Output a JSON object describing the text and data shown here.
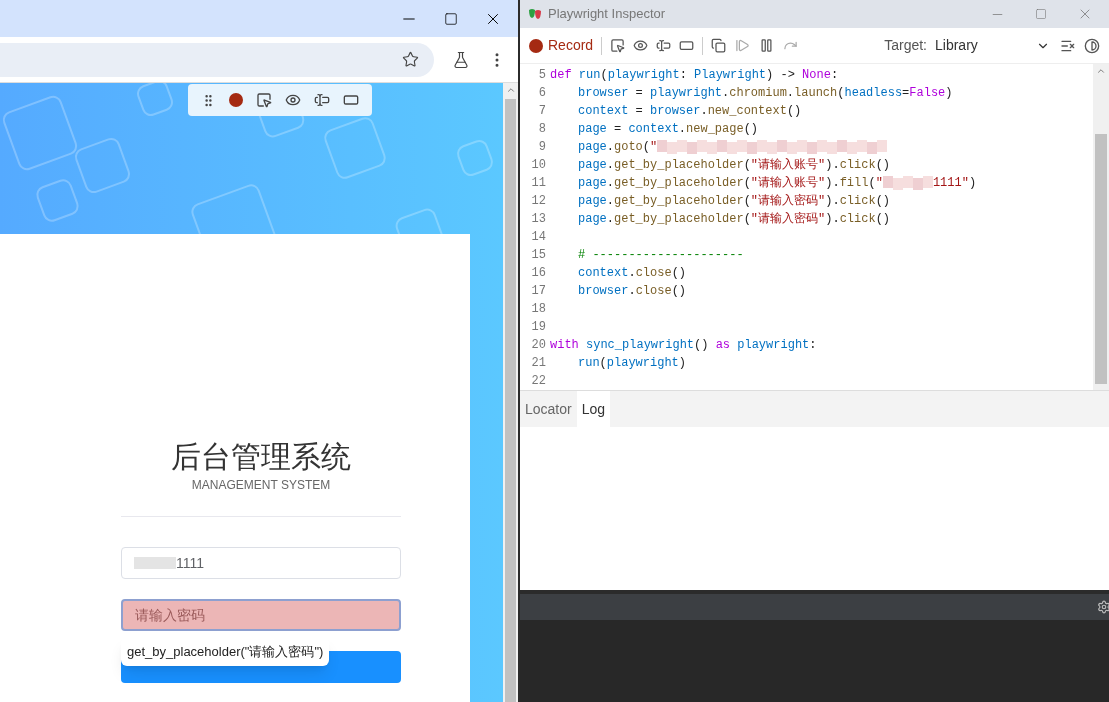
{
  "browser": {
    "login": {
      "title": "后台管理系统",
      "subtitle": "MANAGEMENT SYSTEM",
      "username_value": "1111",
      "password_placeholder": "请输入密码",
      "password_highlighted": true,
      "tooltip": "get_by_placeholder(\"请输入密码\")"
    }
  },
  "inspector": {
    "title": "Playwright Inspector",
    "record_label": "Record",
    "recording": true,
    "target_label": "Target:",
    "target_value": "Library",
    "code_lines": [
      {
        "number": "5",
        "indented": false,
        "tokens": [
          {
            "kind": "keyword",
            "text": "def "
          },
          {
            "kind": "name",
            "text": "run"
          },
          {
            "kind": "plain",
            "text": "("
          },
          {
            "kind": "name",
            "text": "playwright"
          },
          {
            "kind": "plain",
            "text": ": "
          },
          {
            "kind": "name",
            "text": "Playwright"
          },
          {
            "kind": "plain",
            "text": ") -> "
          },
          {
            "kind": "keyword",
            "text": "None"
          },
          {
            "kind": "plain",
            "text": ":"
          }
        ]
      },
      {
        "number": "6",
        "indented": true,
        "tokens": [
          {
            "kind": "name",
            "text": "browser"
          },
          {
            "kind": "plain",
            "text": " = "
          },
          {
            "kind": "name",
            "text": "playwright"
          },
          {
            "kind": "plain",
            "text": "."
          },
          {
            "kind": "func",
            "text": "chromium"
          },
          {
            "kind": "plain",
            "text": "."
          },
          {
            "kind": "func",
            "text": "launch"
          },
          {
            "kind": "plain",
            "text": "("
          },
          {
            "kind": "name",
            "text": "headless"
          },
          {
            "kind": "plain",
            "text": "="
          },
          {
            "kind": "keyword",
            "text": "False"
          },
          {
            "kind": "plain",
            "text": ")"
          }
        ]
      },
      {
        "number": "7",
        "indented": true,
        "tokens": [
          {
            "kind": "name",
            "text": "context"
          },
          {
            "kind": "plain",
            "text": " = "
          },
          {
            "kind": "name",
            "text": "browser"
          },
          {
            "kind": "plain",
            "text": "."
          },
          {
            "kind": "func",
            "text": "new_context"
          },
          {
            "kind": "plain",
            "text": "()"
          }
        ]
      },
      {
        "number": "8",
        "indented": true,
        "tokens": [
          {
            "kind": "name",
            "text": "page"
          },
          {
            "kind": "plain",
            "text": " = "
          },
          {
            "kind": "name",
            "text": "context"
          },
          {
            "kind": "plain",
            "text": "."
          },
          {
            "kind": "func",
            "text": "new_page"
          },
          {
            "kind": "plain",
            "text": "()"
          }
        ]
      },
      {
        "number": "9",
        "indented": true,
        "tokens": [
          {
            "kind": "name",
            "text": "page"
          },
          {
            "kind": "plain",
            "text": "."
          },
          {
            "kind": "func",
            "text": "goto"
          },
          {
            "kind": "plain",
            "text": "("
          },
          {
            "kind": "string",
            "text": "\""
          },
          {
            "kind": "blur"
          }
        ]
      },
      {
        "number": "10",
        "indented": true,
        "tokens": [
          {
            "kind": "name",
            "text": "page"
          },
          {
            "kind": "plain",
            "text": "."
          },
          {
            "kind": "func",
            "text": "get_by_placeholder"
          },
          {
            "kind": "plain",
            "text": "("
          },
          {
            "kind": "string",
            "text": "\"请输入账号\""
          },
          {
            "kind": "plain",
            "text": ")."
          },
          {
            "kind": "func",
            "text": "click"
          },
          {
            "kind": "plain",
            "text": "()"
          }
        ]
      },
      {
        "number": "11",
        "indented": true,
        "tokens": [
          {
            "kind": "name",
            "text": "page"
          },
          {
            "kind": "plain",
            "text": "."
          },
          {
            "kind": "func",
            "text": "get_by_placeholder"
          },
          {
            "kind": "plain",
            "text": "("
          },
          {
            "kind": "string",
            "text": "\"请输入账号\""
          },
          {
            "kind": "plain",
            "text": ")."
          },
          {
            "kind": "func",
            "text": "fill"
          },
          {
            "kind": "plain",
            "text": "("
          },
          {
            "kind": "string",
            "text": "\""
          },
          {
            "kind": "smudge"
          },
          {
            "kind": "string",
            "text": "1111\""
          },
          {
            "kind": "plain",
            "text": ")"
          }
        ]
      },
      {
        "number": "12",
        "indented": true,
        "tokens": [
          {
            "kind": "name",
            "text": "page"
          },
          {
            "kind": "plain",
            "text": "."
          },
          {
            "kind": "func",
            "text": "get_by_placeholder"
          },
          {
            "kind": "plain",
            "text": "("
          },
          {
            "kind": "string",
            "text": "\"请输入密码\""
          },
          {
            "kind": "plain",
            "text": ")."
          },
          {
            "kind": "func",
            "text": "click"
          },
          {
            "kind": "plain",
            "text": "()"
          }
        ]
      },
      {
        "number": "13",
        "indented": true,
        "tokens": [
          {
            "kind": "name",
            "text": "page"
          },
          {
            "kind": "plain",
            "text": "."
          },
          {
            "kind": "func",
            "text": "get_by_placeholder"
          },
          {
            "kind": "plain",
            "text": "("
          },
          {
            "kind": "string",
            "text": "\"请输入密码\""
          },
          {
            "kind": "plain",
            "text": ")."
          },
          {
            "kind": "func",
            "text": "click"
          },
          {
            "kind": "plain",
            "text": "()"
          }
        ]
      },
      {
        "number": "14"
      },
      {
        "number": "15",
        "indented": true,
        "tokens": [
          {
            "kind": "comment",
            "text": "# ---------------------"
          }
        ]
      },
      {
        "number": "16",
        "indented": true,
        "tokens": [
          {
            "kind": "name",
            "text": "context"
          },
          {
            "kind": "plain",
            "text": "."
          },
          {
            "kind": "func",
            "text": "close"
          },
          {
            "kind": "plain",
            "text": "()"
          }
        ]
      },
      {
        "number": "17",
        "indented": true,
        "tokens": [
          {
            "kind": "name",
            "text": "browser"
          },
          {
            "kind": "plain",
            "text": "."
          },
          {
            "kind": "func",
            "text": "close"
          },
          {
            "kind": "plain",
            "text": "()"
          }
        ]
      },
      {
        "number": "18"
      },
      {
        "number": "19"
      },
      {
        "number": "20",
        "indented": false,
        "tokens": [
          {
            "kind": "keyword",
            "text": "with "
          },
          {
            "kind": "name",
            "text": "sync_playwright"
          },
          {
            "kind": "plain",
            "text": "() "
          },
          {
            "kind": "keyword",
            "text": "as "
          },
          {
            "kind": "name",
            "text": "playwright"
          },
          {
            "kind": "plain",
            "text": ":"
          }
        ]
      },
      {
        "number": "21",
        "indented": true,
        "tokens": [
          {
            "kind": "name",
            "text": "run"
          },
          {
            "kind": "plain",
            "text": "("
          },
          {
            "kind": "name",
            "text": "playwright"
          },
          {
            "kind": "plain",
            "text": ")"
          }
        ]
      },
      {
        "number": "22"
      }
    ],
    "tabs": [
      {
        "label": "Locator",
        "selected": false
      },
      {
        "label": "Log",
        "selected": true
      }
    ]
  }
}
